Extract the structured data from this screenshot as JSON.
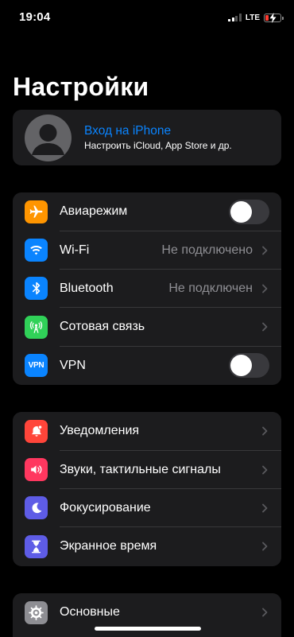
{
  "status": {
    "time": "19:04",
    "network": "LTE"
  },
  "page": {
    "title": "Настройки"
  },
  "profile": {
    "title": "Вход на iPhone",
    "subtitle": "Настроить iCloud, App Store и др."
  },
  "connectivity": [
    {
      "label": "Авиарежим",
      "icon": "airplane-icon",
      "color": "#ff9500",
      "control": "toggle",
      "on": false
    },
    {
      "label": "Wi-Fi",
      "value": "Не подключено",
      "icon": "wifi-icon",
      "color": "#0a84ff",
      "control": "chevron"
    },
    {
      "label": "Bluetooth",
      "value": "Не подключен",
      "icon": "bluetooth-icon",
      "color": "#0a84ff",
      "control": "chevron"
    },
    {
      "label": "Сотовая связь",
      "icon": "cellular-icon",
      "color": "#30d158",
      "control": "chevron"
    },
    {
      "label": "VPN",
      "icon_text": "VPN",
      "icon": "vpn-icon",
      "color": "#0a84ff",
      "control": "toggle",
      "on": false
    }
  ],
  "notifications": [
    {
      "label": "Уведомления",
      "icon": "notifications-icon",
      "color": "#ff453a"
    },
    {
      "label": "Звуки, тактильные сигналы",
      "icon": "sound-icon",
      "color": "#ff375f"
    },
    {
      "label": "Фокусирование",
      "icon": "moon-icon",
      "color": "#5e5ce6"
    },
    {
      "label": "Экранное время",
      "icon": "hourglass-icon",
      "color": "#5e5ce6"
    }
  ],
  "general": [
    {
      "label": "Основные",
      "icon": "gear-icon",
      "color": "#8e8e93"
    }
  ]
}
